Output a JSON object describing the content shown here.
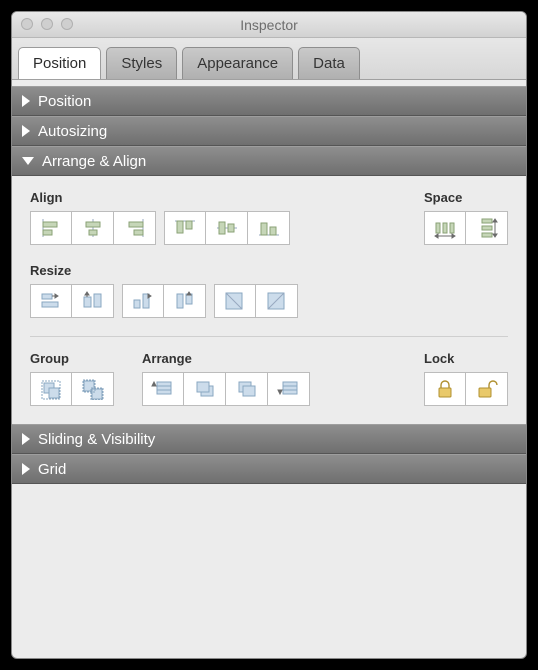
{
  "window": {
    "title": "Inspector"
  },
  "tabs": {
    "position": "Position",
    "styles": "Styles",
    "appearance": "Appearance",
    "data": "Data"
  },
  "sections": {
    "position": "Position",
    "autosizing": "Autosizing",
    "arrange_align": "Arrange & Align",
    "sliding_visibility": "Sliding & Visibility",
    "grid": "Grid"
  },
  "labels": {
    "align": "Align",
    "space": "Space",
    "resize": "Resize",
    "group": "Group",
    "arrange": "Arrange",
    "lock": "Lock"
  }
}
